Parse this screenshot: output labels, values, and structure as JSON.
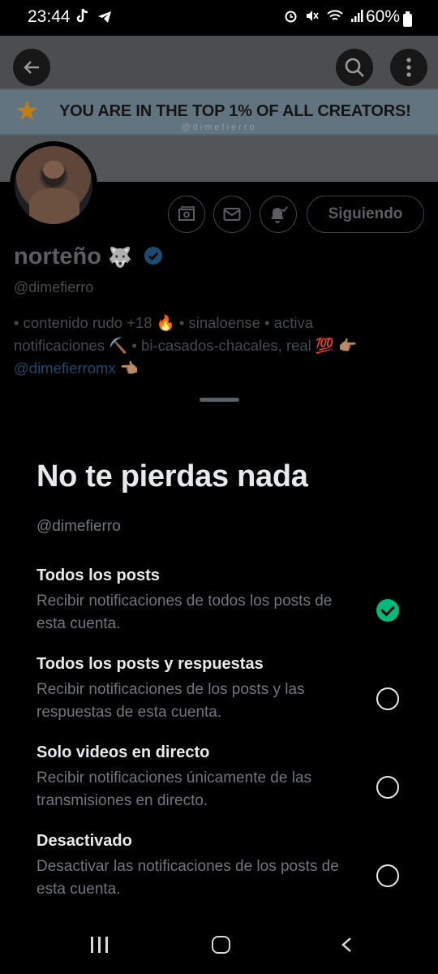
{
  "status_bar": {
    "time": "23:44",
    "left_icons": [
      "tiktok-icon",
      "telegram-icon"
    ],
    "right_icons": [
      "alarm-icon",
      "mute-icon",
      "wifi-icon",
      "signal-icon"
    ],
    "battery": "60%"
  },
  "banner": {
    "text": "YOU ARE IN THE TOP 1% OF ALL CREATORS!",
    "watermark": "@dimefierro"
  },
  "profile": {
    "name": "norteño",
    "name_emoji": "🐺",
    "verified": true,
    "handle": "@dimefierro",
    "following_label": "Siguiendo",
    "bio_line1": "• contenido rudo +18 🔥 • sinaloense • activa",
    "bio_line2": "notificaciones ⛏️ • bi-casados-chacales, real 💯 👉🏽",
    "bio_link": "@dimefierromx",
    "bio_link_emoji": "👈🏽"
  },
  "sheet": {
    "title": "No te pierdas nada",
    "handle": "@dimefierro",
    "options": [
      {
        "title": "Todos los posts",
        "description": "Recibir notificaciones de todos los posts de esta cuenta.",
        "selected": true
      },
      {
        "title": "Todos los posts y respuestas",
        "description": "Recibir notificaciones de los posts y las respuestas de esta cuenta.",
        "selected": false
      },
      {
        "title": "Solo videos en directo",
        "description": "Recibir notificaciones únicamente de las transmisiones en directo.",
        "selected": false
      },
      {
        "title": "Desactivado",
        "description": "Desactivar las notificaciones de los posts de esta cuenta.",
        "selected": false
      }
    ]
  },
  "colors": {
    "selected_green": "#00ba7c",
    "verified_blue": "#1d9bf0",
    "text_primary": "#e7e9ea",
    "text_secondary": "#71767b"
  }
}
